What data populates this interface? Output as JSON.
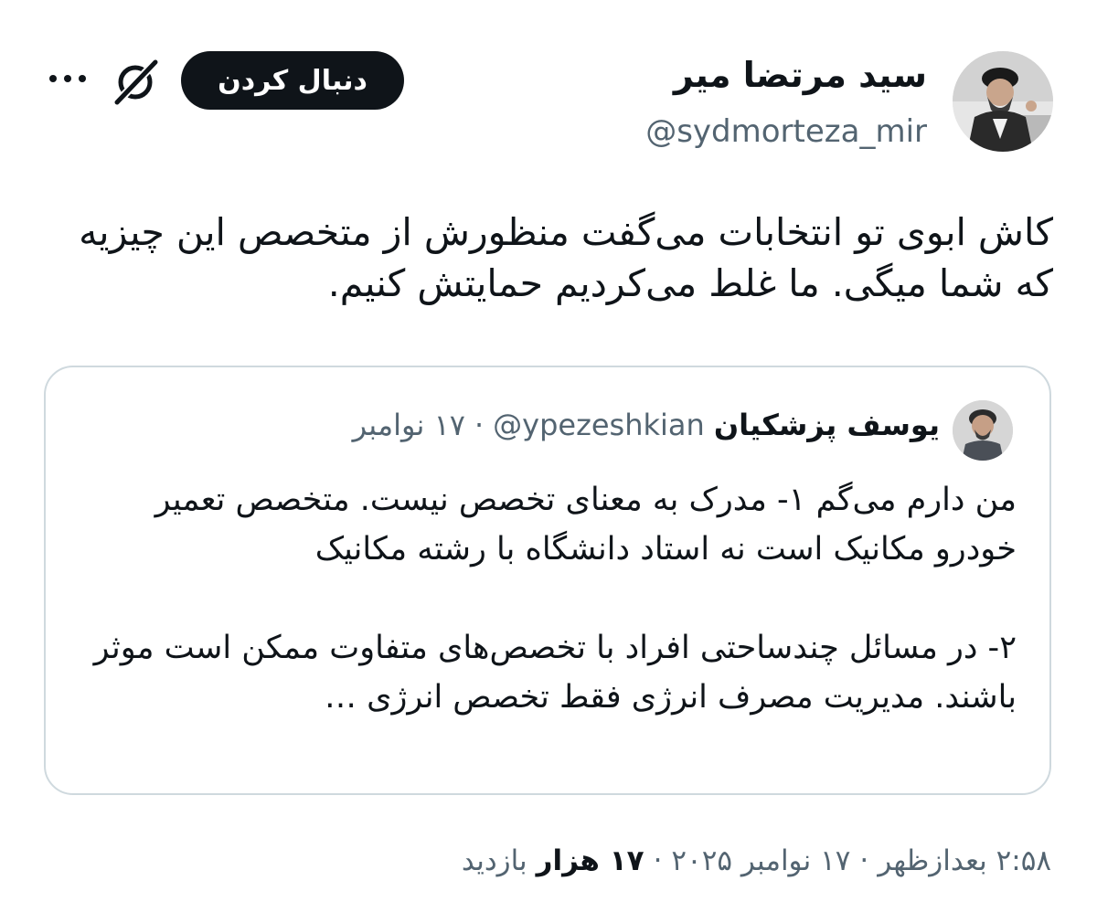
{
  "author": {
    "name": "سید مرتضا میر",
    "handle": "@sydmorteza_mir"
  },
  "actions": {
    "follow_label": "دنبال کردن",
    "grok_icon": "grok-icon",
    "more_icon": "more-icon"
  },
  "tweet": {
    "text": "کاش ابوی تو انتخابات می‌گفت منظورش از متخصص این چیزیه که شما میگی. ما غلط می‌کردیم حمایتش کنیم."
  },
  "quote": {
    "name": "یوسف پزشکیان",
    "handle": "@ypezeshkian",
    "dot": "·",
    "date": "۱۷ نوامبر",
    "text": "من دارم می‌گم ۱- مدرک به معنای تخصص نیست. متخصص تعمیر خودرو مکانیک است نه استاد دانشگاه با رشته مکانیک\n\n۲- در مسائل چندساحتی افراد با تخصص‌های متفاوت ممکن است موثر باشند. مدیریت مصرف انرژی فقط تخصص  انرژی …"
  },
  "meta": {
    "time": "۲:۵۸ بعدازظهر",
    "dot1": "·",
    "date": "۱۷ نوامبر ۲۰۲۵",
    "dot2": "·",
    "views_count": "۱۷ هزار",
    "views_label": "بازدید"
  },
  "colors": {
    "text": "#0f1419",
    "secondary": "#536471",
    "border": "#cfd9de",
    "button_bg": "#0f1419",
    "button_text": "#ffffff"
  }
}
